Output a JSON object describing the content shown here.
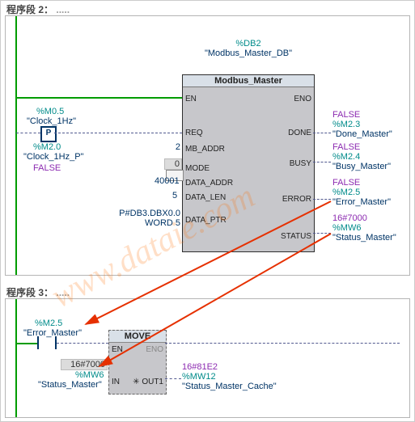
{
  "seg2": {
    "title": "程序段 2：",
    "title_dots": ".....",
    "instance_addr": "%DB2",
    "instance_name": "\"Modbus_Master_DB\"",
    "block": "Modbus_Master",
    "pins_left": {
      "EN": "EN",
      "REQ": "REQ",
      "MB_ADDR": "MB_ADDR",
      "MODE": "MODE",
      "DATA_ADDR": "DATA_ADDR",
      "DATA_LEN": "DATA_LEN",
      "DATA_PTR": "DATA_PTR"
    },
    "pins_right": {
      "ENO": "ENO",
      "DONE": "DONE",
      "BUSY": "BUSY",
      "ERROR": "ERROR",
      "STATUS": "STATUS"
    },
    "in": {
      "clock_addr": "%M0.5",
      "clock_name": "\"Clock_1Hz\"",
      "clockP_addr": "%M2.0",
      "clockP_name": "\"Clock_1Hz_P\"",
      "clockP_value": "FALSE",
      "contact_P": "P",
      "mb_addr": "2",
      "mode": "0",
      "data_addr": "40001",
      "data_len": "5",
      "data_ptr_line1": "P#DB3.DBX0.0",
      "data_ptr_line2": "WORD 5"
    },
    "out": {
      "done_val": "FALSE",
      "done_addr": "%M2.3",
      "done_name": "\"Done_Master\"",
      "busy_val": "FALSE",
      "busy_addr": "%M2.4",
      "busy_name": "\"Busy_Master\"",
      "error_val": "FALSE",
      "error_addr": "%M2.5",
      "error_name": "\"Error_Master\"",
      "status_val": "16#7000",
      "status_addr": "%MW6",
      "status_name": "\"Status_Master\""
    }
  },
  "seg3": {
    "title": "程序段 3：",
    "title_dots": ".....",
    "contact_addr": "%M2.5",
    "contact_name": "\"Error_Master\"",
    "block": "MOVE",
    "pins": {
      "EN": "EN",
      "ENO": "ENO",
      "IN": "IN",
      "OUT1": "OUT1"
    },
    "in_val": "16#7000",
    "in_addr": "%MW6",
    "in_name": "\"Status_Master\"",
    "out_val": "16#81E2",
    "out_addr": "%MW12",
    "out_name": "\"Status_Master_Cache\""
  },
  "watermark": "www.dataie.com",
  "colors": {
    "green": "#009c00",
    "teal": "#008b8a",
    "blue": "#003466",
    "purple": "#8c2bb1",
    "red": "#e63000"
  }
}
